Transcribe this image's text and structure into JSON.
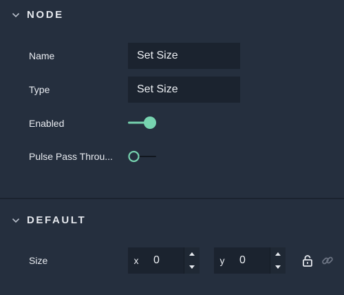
{
  "sections": {
    "node": {
      "title": "NODE"
    },
    "default": {
      "title": "DEFAULT"
    }
  },
  "node": {
    "name_label": "Name",
    "name_value": "Set Size",
    "type_label": "Type",
    "type_value": "Set Size",
    "enabled_label": "Enabled",
    "enabled_on": true,
    "pulse_label": "Pulse Pass Throu...",
    "pulse_on": false
  },
  "default": {
    "size_label": "Size",
    "x_axis": "x",
    "x_value": "0",
    "y_axis": "y",
    "y_value": "0"
  },
  "colors": {
    "background": "#252f3e",
    "field_bg": "#1b232f",
    "accent": "#77d4b0",
    "text": "#e9ecf1",
    "icon_muted": "#6b7382"
  },
  "icons": {
    "collapse": "chevron-down-icon",
    "increment": "caret-up-icon",
    "decrement": "caret-down-icon",
    "lock": "lock-open-icon",
    "link": "link-icon"
  }
}
